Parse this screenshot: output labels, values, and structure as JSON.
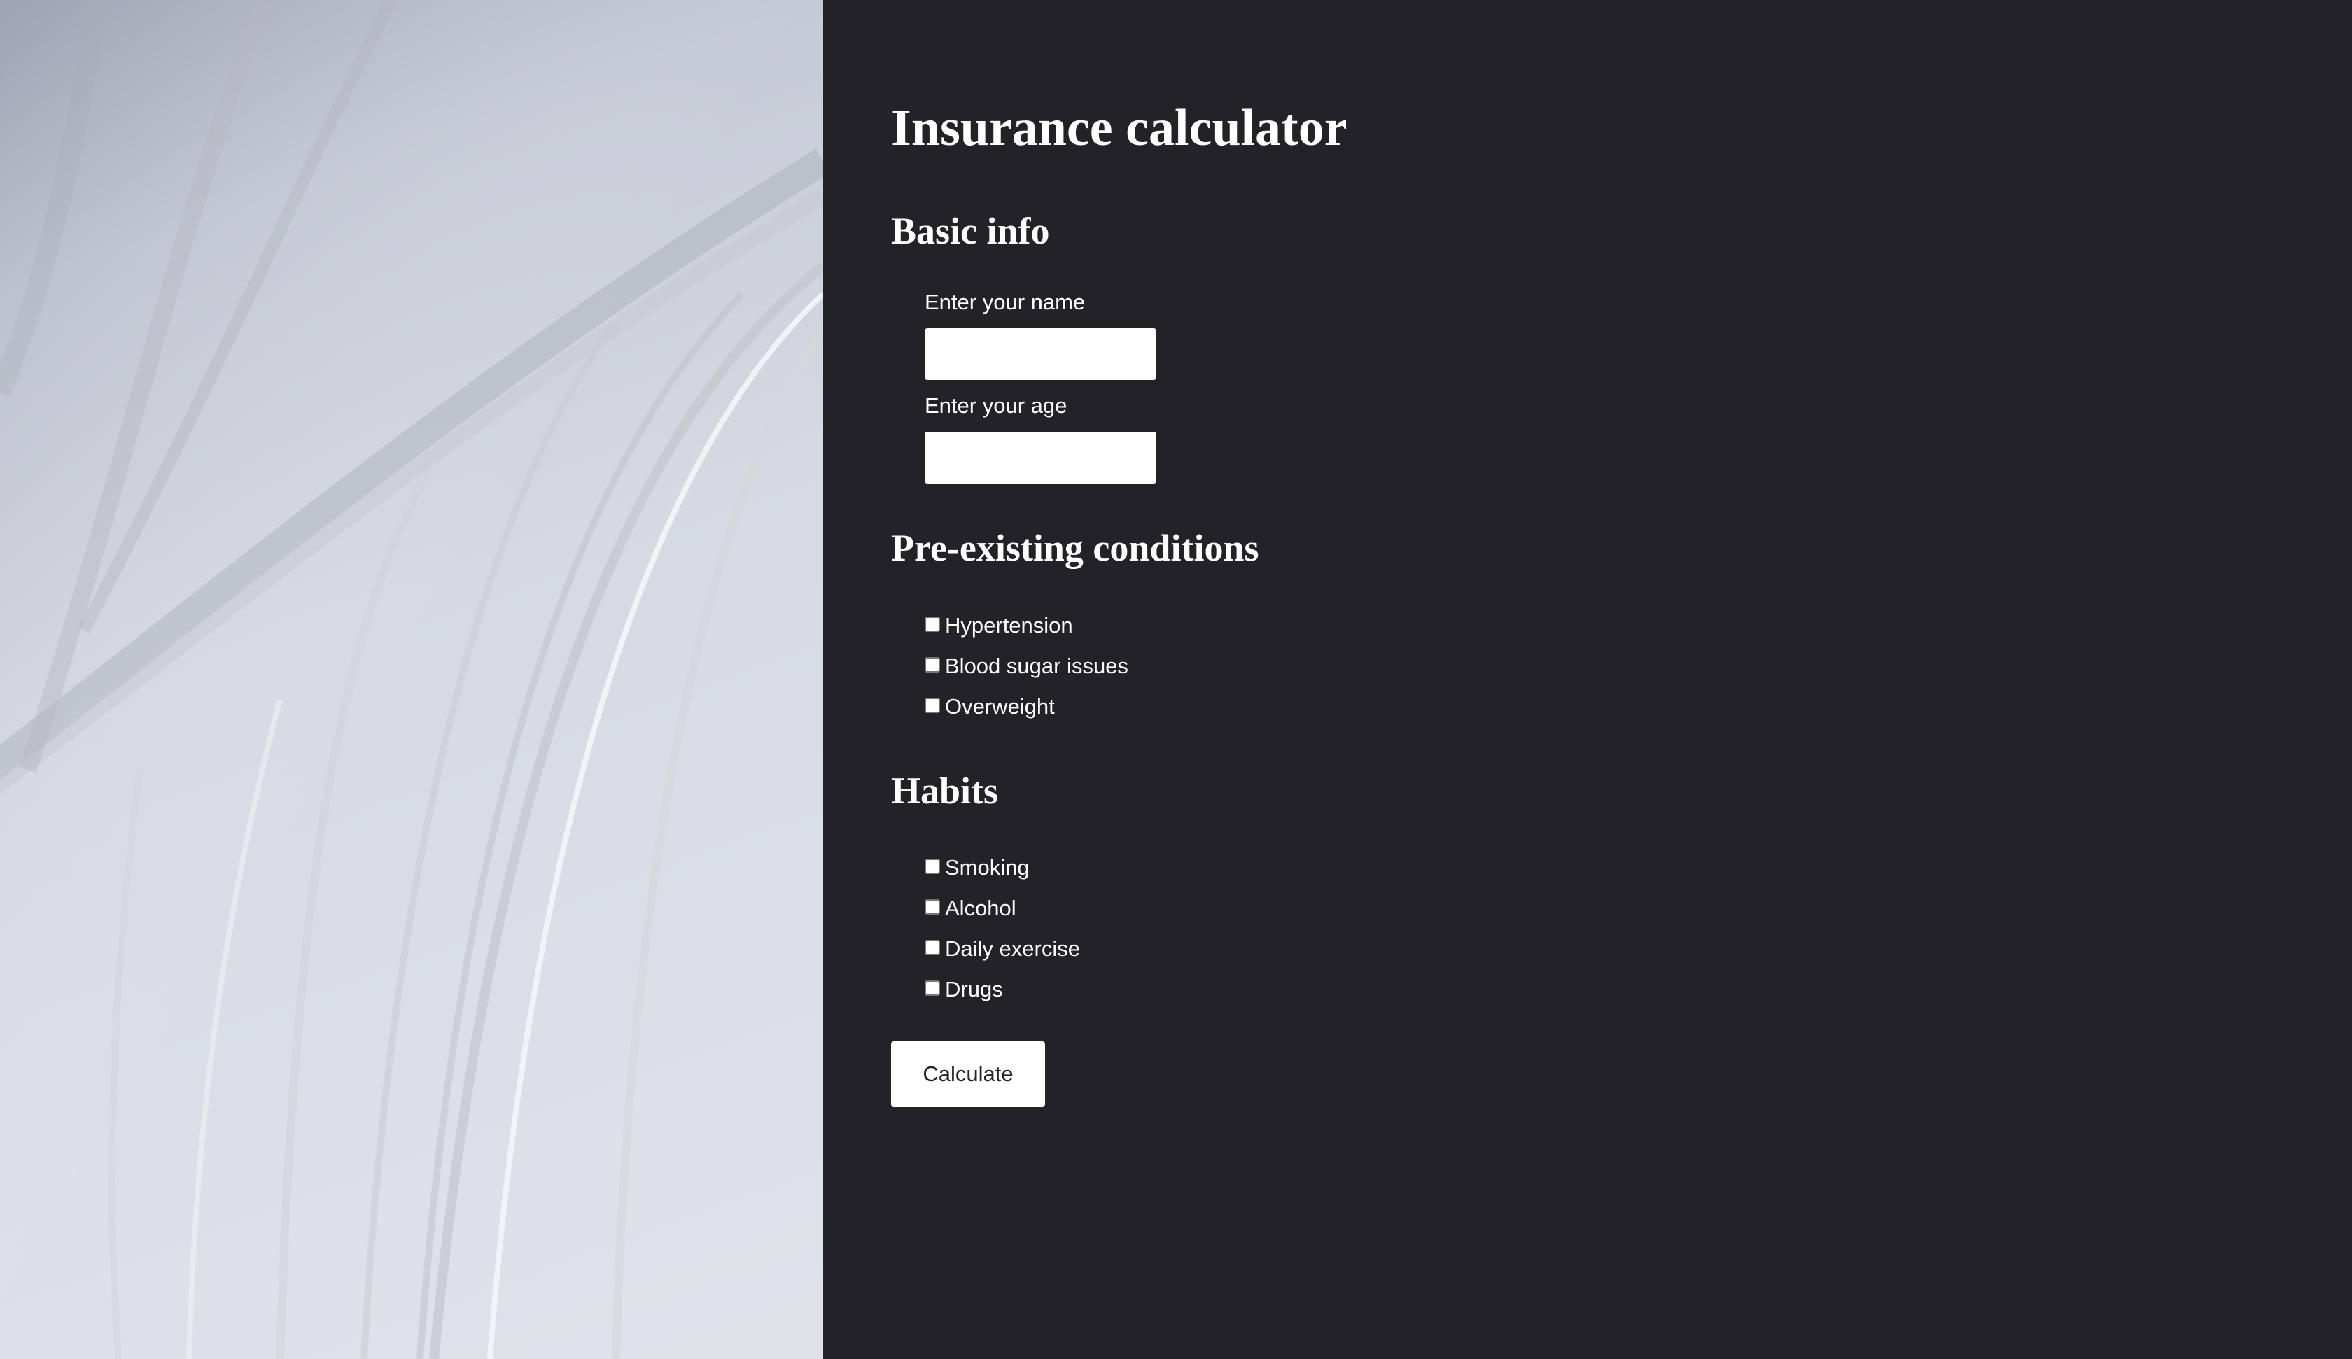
{
  "page": {
    "title": "Insurance calculator"
  },
  "basic_info": {
    "heading": "Basic info",
    "name_label": "Enter your name",
    "name_value": "",
    "age_label": "Enter your age",
    "age_value": ""
  },
  "conditions": {
    "heading": "Pre-existing conditions",
    "items": [
      {
        "label": "Hypertension",
        "checked": false
      },
      {
        "label": "Blood sugar issues",
        "checked": false
      },
      {
        "label": "Overweight",
        "checked": false
      }
    ]
  },
  "habits": {
    "heading": "Habits",
    "items": [
      {
        "label": "Smoking",
        "checked": false
      },
      {
        "label": "Alcohol",
        "checked": false
      },
      {
        "label": "Daily exercise",
        "checked": false
      },
      {
        "label": "Drugs",
        "checked": false
      }
    ]
  },
  "actions": {
    "calculate_label": "Calculate"
  },
  "colors": {
    "panel_background": "#232228",
    "text": "#ffffff",
    "input_background": "#ffffff"
  }
}
